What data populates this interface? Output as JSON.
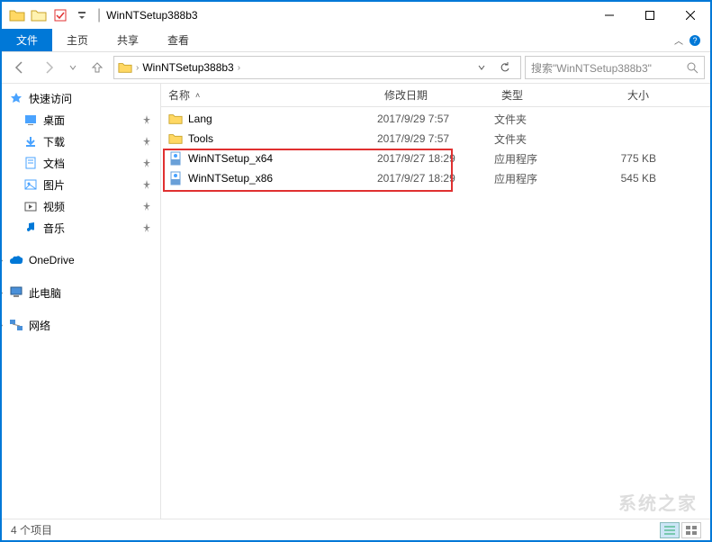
{
  "titlebar": {
    "title": "WinNTSetup388b3",
    "separator": "|"
  },
  "ribbon": {
    "file": "文件",
    "tabs": [
      "主页",
      "共享",
      "查看"
    ]
  },
  "address": {
    "crumb": "WinNTSetup388b3"
  },
  "search": {
    "placeholder": "搜索\"WinNTSetup388b3\""
  },
  "sidebar": {
    "quick": "快速访问",
    "items": [
      {
        "label": "桌面",
        "color": "#0078d7"
      },
      {
        "label": "下载",
        "color": "#0078d7"
      },
      {
        "label": "文档",
        "color": "#0078d7"
      },
      {
        "label": "图片",
        "color": "#0078d7"
      },
      {
        "label": "视频",
        "color": "#555"
      },
      {
        "label": "音乐",
        "color": "#0078d7"
      }
    ],
    "onedrive": "OneDrive",
    "thispc": "此电脑",
    "network": "网络"
  },
  "columns": {
    "name": "名称",
    "date": "修改日期",
    "type": "类型",
    "size": "大小"
  },
  "files": [
    {
      "name": "Lang",
      "date": "2017/9/29 7:57",
      "type": "文件夹",
      "size": "",
      "kind": "folder"
    },
    {
      "name": "Tools",
      "date": "2017/9/29 7:57",
      "type": "文件夹",
      "size": "",
      "kind": "folder"
    },
    {
      "name": "WinNTSetup_x64",
      "date": "2017/9/27 18:29",
      "type": "应用程序",
      "size": "775 KB",
      "kind": "exe"
    },
    {
      "name": "WinNTSetup_x86",
      "date": "2017/9/27 18:29",
      "type": "应用程序",
      "size": "545 KB",
      "kind": "exe"
    }
  ],
  "status": {
    "text": "4 个项目"
  },
  "watermark": "系统之家"
}
